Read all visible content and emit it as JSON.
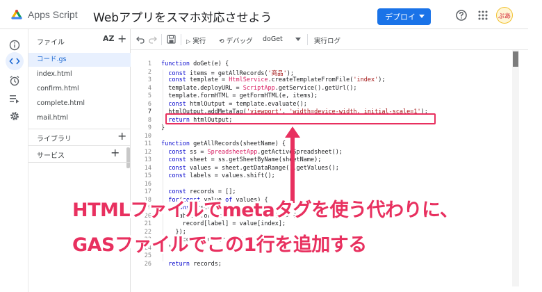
{
  "header": {
    "app_name": "Apps Script",
    "project_title": "Webアプリをスマホ対応させよう",
    "deploy_label": "デプロイ",
    "avatar_text": "ぷあ"
  },
  "files_panel": {
    "title": "ファイル",
    "sort_label": "AZ",
    "files": [
      {
        "name": "コード.gs",
        "active": true
      },
      {
        "name": "index.html",
        "active": false
      },
      {
        "name": "confirm.html",
        "active": false
      },
      {
        "name": "complete.html",
        "active": false
      },
      {
        "name": "mail.html",
        "active": false
      }
    ],
    "libraries_label": "ライブラリ",
    "services_label": "サービス"
  },
  "toolbar": {
    "run_label": "実行",
    "debug_label": "デバッグ",
    "function_select": "doGet",
    "log_label": "実行ログ"
  },
  "editor": {
    "current_line": 7,
    "lines": [
      {
        "n": "1",
        "text": "function doGet(e) {"
      },
      {
        "n": "2",
        "text": "  const items = getAllRecords('商品');"
      },
      {
        "n": "3",
        "text": "  const template = HtmlService.createTemplateFromFile('index');"
      },
      {
        "n": "4",
        "text": "  template.deployURL = ScriptApp.getService().getUrl();"
      },
      {
        "n": "5",
        "text": "  template.formHTML = getFormHTML(e, items);"
      },
      {
        "n": "6",
        "text": "  const htmlOutput = template.evaluate();"
      },
      {
        "n": "7",
        "text": "  htmlOutput.addMetaTag('viewport', 'width=device-width, initial-scale=1');"
      },
      {
        "n": "8",
        "text": "  return htmlOutput;"
      },
      {
        "n": "9",
        "text": "}"
      },
      {
        "n": "10",
        "text": ""
      },
      {
        "n": "11",
        "text": "function getAllRecords(sheetName) {"
      },
      {
        "n": "12",
        "text": "  const ss = SpreadsheetApp.getActiveSpreadsheet();"
      },
      {
        "n": "13",
        "text": "  const sheet = ss.getSheetByName(sheetName);"
      },
      {
        "n": "14",
        "text": "  const values = sheet.getDataRange().getValues();"
      },
      {
        "n": "15",
        "text": "  const labels = values.shift();"
      },
      {
        "n": "16",
        "text": ""
      },
      {
        "n": "17",
        "text": "  const records = [];"
      },
      {
        "n": "18",
        "text": "  for(const value of values) {"
      },
      {
        "n": "19",
        "text": "    const record = {};"
      },
      {
        "n": "20",
        "text": "    labels.forEach((label, index) => {"
      },
      {
        "n": "21",
        "text": "      record[label] = value[index];"
      },
      {
        "n": "22",
        "text": "    });"
      },
      {
        "n": "23",
        "text": "    records.push(record);"
      },
      {
        "n": "24",
        "text": "  }"
      },
      {
        "n": "25",
        "text": ""
      },
      {
        "n": "26",
        "text": "  return records;"
      }
    ]
  },
  "annotation": {
    "line1": "HTMLファイルでmetaタグを使う代わりに、",
    "line2": "GASファイルでこの1行を追加する"
  },
  "colors": {
    "accent": "#1a73e8",
    "annotation": "#e8305f"
  }
}
